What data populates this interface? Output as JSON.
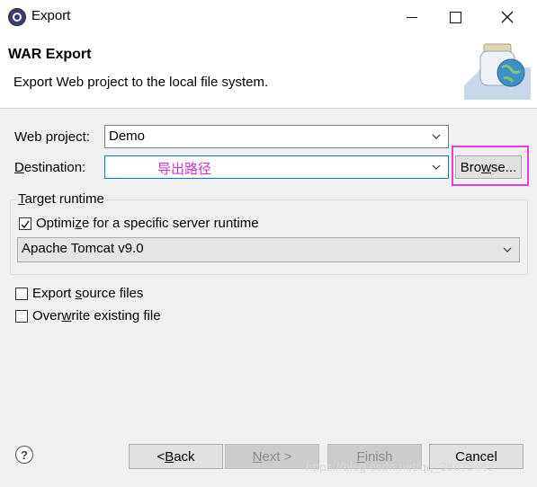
{
  "window": {
    "title": "Export",
    "minimize": "—",
    "maximize": "□",
    "close": "✕"
  },
  "header": {
    "title": "WAR Export",
    "description": "Export Web project to the local file system.",
    "logo_icon": "jar-globe-icon"
  },
  "form": {
    "web_project": {
      "label_pre": "Web pro",
      "label_mnemonic": "j",
      "label_post": "ect:",
      "value": "Demo"
    },
    "destination": {
      "label_mnemonic": "D",
      "label_post": "estination:",
      "value": "导出路径",
      "value_color": "#cc33cc"
    },
    "browse_button": {
      "label_pre": "Bro",
      "label_mnemonic": "w",
      "label_post": "se..."
    },
    "target_runtime": {
      "legend_mnemonic": "T",
      "legend_post": "arget runtime",
      "optimize": {
        "checked": true,
        "label_pre": "Optimi",
        "label_mnemonic": "z",
        "label_post": "e for a specific server runtime"
      },
      "runtime_value": "Apache Tomcat v9.0"
    },
    "export_source": {
      "checked": false,
      "label_pre": "Export ",
      "label_mnemonic": "s",
      "label_post": "ource files"
    },
    "overwrite": {
      "checked": false,
      "label_pre": "Over",
      "label_mnemonic": "w",
      "label_post": "rite existing file"
    }
  },
  "footer": {
    "help": "?",
    "back": {
      "pre": "< ",
      "mnemonic": "B",
      "post": "ack"
    },
    "next": {
      "pre": "",
      "mnemonic": "N",
      "post": "ext >"
    },
    "finish": {
      "pre": "",
      "mnemonic": "F",
      "post": "inish"
    },
    "cancel": "Cancel",
    "watermark": "https://blog.csdn.net/qq_38675449"
  },
  "highlight_color": "#e040e0"
}
